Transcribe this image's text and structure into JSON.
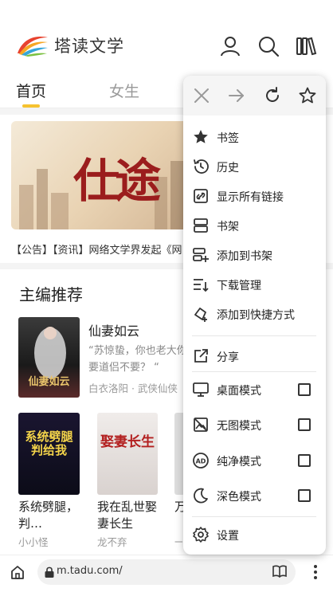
{
  "header": {
    "logo_text": "塔读文学"
  },
  "tabs": [
    {
      "label": "首页",
      "active": true
    },
    {
      "label": "女生",
      "active": false
    }
  ],
  "banner": {
    "title": "仕途"
  },
  "announcement": "【公告】【资讯】网络文学界发起《网",
  "section": {
    "title": "主编推荐"
  },
  "featured_book": {
    "title": "仙妻如云",
    "description": "“苏惊蛰，你也老大你要道侣不要？ “",
    "meta": "白衣洛阳 · 武侠仙侠",
    "cover_text": "仙妻如云"
  },
  "grid_books": [
    {
      "title": "系统劈腿，判…",
      "author": "小小怪",
      "cover_text": "系统劈腿判给我"
    },
    {
      "title": "我在乱世娶妻长生",
      "author": "龙不弃",
      "cover_text": "娶妻长生"
    },
    {
      "title": "万",
      "author": "一",
      "cover_text": ""
    }
  ],
  "address_bar": {
    "url": "m.tadu.com/"
  },
  "menu": {
    "toolbar": [
      "close-icon",
      "forward-icon",
      "reload-icon",
      "star-icon"
    ],
    "items": [
      {
        "label": "书签",
        "icon": "star-filled-icon"
      },
      {
        "label": "历史",
        "icon": "history-icon"
      },
      {
        "label": "显示所有链接",
        "icon": "link-icon"
      },
      {
        "label": "书架",
        "icon": "bookshelf-icon"
      },
      {
        "label": "添加到书架",
        "icon": "add-to-bookshelf-icon"
      },
      {
        "label": "下载管理",
        "icon": "download-icon"
      },
      {
        "label": "添加到快捷方式",
        "icon": "shortcut-icon"
      },
      {
        "label": "分享",
        "icon": "share-icon"
      },
      {
        "label": "桌面模式",
        "icon": "desktop-icon",
        "checked": false
      },
      {
        "label": "无图模式",
        "icon": "no-image-icon",
        "checked": false
      },
      {
        "label": "纯净模式",
        "icon": "ad-block-icon",
        "checked": false
      },
      {
        "label": "深色模式",
        "icon": "dark-mode-icon",
        "checked": false
      },
      {
        "label": "设置",
        "icon": "settings-icon"
      }
    ]
  },
  "colors": {
    "accent_yellow": "#f6c22f",
    "banner_red": "#9b1d1d"
  }
}
